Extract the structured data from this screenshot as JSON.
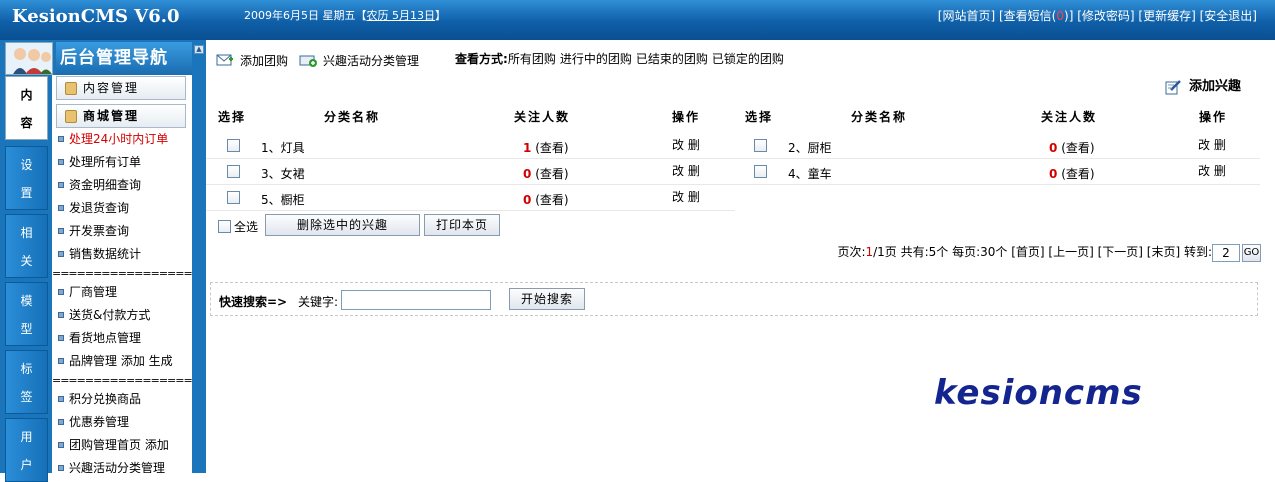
{
  "app": {
    "title": "KesionCMS V6.0",
    "date": "2009年6月5日 星期五【",
    "lunar": "农历 5月13日",
    "date_end": "】"
  },
  "toplinks": {
    "site_home": "[网站首页]",
    "messages_prefix": "[查看短信(",
    "messages_count": "0",
    "messages_suffix": ")]",
    "change_password": "[修改密码]",
    "refresh_cache": "[更新缓存]",
    "logout": "[安全退出]"
  },
  "sidebar": {
    "title": "后台管理导航",
    "tabs": [
      {
        "c1": "内",
        "c2": "容"
      },
      {
        "c1": "设",
        "c2": "置"
      },
      {
        "c1": "相",
        "c2": "关"
      },
      {
        "c1": "模",
        "c2": "型"
      },
      {
        "c1": "标",
        "c2": "签"
      },
      {
        "c1": "用",
        "c2": "户"
      }
    ],
    "content_mgmt": "内容管理",
    "mall_mgmt": "商城管理",
    "items": [
      "处理24小时内订单",
      "处理所有订单",
      "资金明细查询",
      "发退货查询",
      "开发票查询",
      "销售数据统计",
      "厂商管理",
      "送货&付款方式",
      "看货地点管理",
      "品牌管理 添加 生成",
      "积分兑换商品",
      "优惠券管理",
      "团购管理首页 添加",
      "兴趣活动分类管理"
    ],
    "separator": "====================="
  },
  "toolbar": {
    "add_group": "添加团购",
    "interest_category": "兴趣活动分类管理",
    "view_label": "查看方式:",
    "view_options": [
      "所有团购",
      "进行中的团购",
      "已结束的团购",
      "已锁定的团购"
    ],
    "add_interest": "添加兴趣"
  },
  "table": {
    "headers": {
      "select": "选择",
      "name": "分类名称",
      "followers": "关注人数",
      "action": "操作"
    },
    "left_rows": [
      {
        "name": "1、灯具",
        "count": "1",
        "view": "(查看)",
        "actions": "改 删"
      },
      {
        "name": "3、女裙",
        "count": "0",
        "view": "(查看)",
        "actions": "改 删"
      },
      {
        "name": "5、橱柜",
        "count": "0",
        "view": "(查看)",
        "actions": "改 删"
      }
    ],
    "right_rows": [
      {
        "name": "2、厨柜",
        "count": "0",
        "view": "(查看)",
        "actions": "改 删"
      },
      {
        "name": "4、童车",
        "count": "0",
        "view": "(查看)",
        "actions": "改 删"
      }
    ]
  },
  "actions": {
    "select_all": "全选",
    "delete_selected": "删除选中的兴趣",
    "print_page": "打印本页"
  },
  "pager": {
    "page_label": "页次:",
    "page_current": "1",
    "page_rest": "/1页 共有:5个 每页:30个 [首页] [上一页] [下一页] [末页] 转到:",
    "goto_value": "2",
    "go": "GO"
  },
  "search": {
    "label": "快速搜索=>",
    "keyword": "关键字:",
    "input_value": "",
    "button": "开始搜索"
  },
  "footer_logo": "kesioncms",
  "colors": {
    "topbar": "#0f5fa8",
    "sidebar": "#1a75bb",
    "accent_red": "#d40000",
    "logo_blue": "#14258f"
  }
}
